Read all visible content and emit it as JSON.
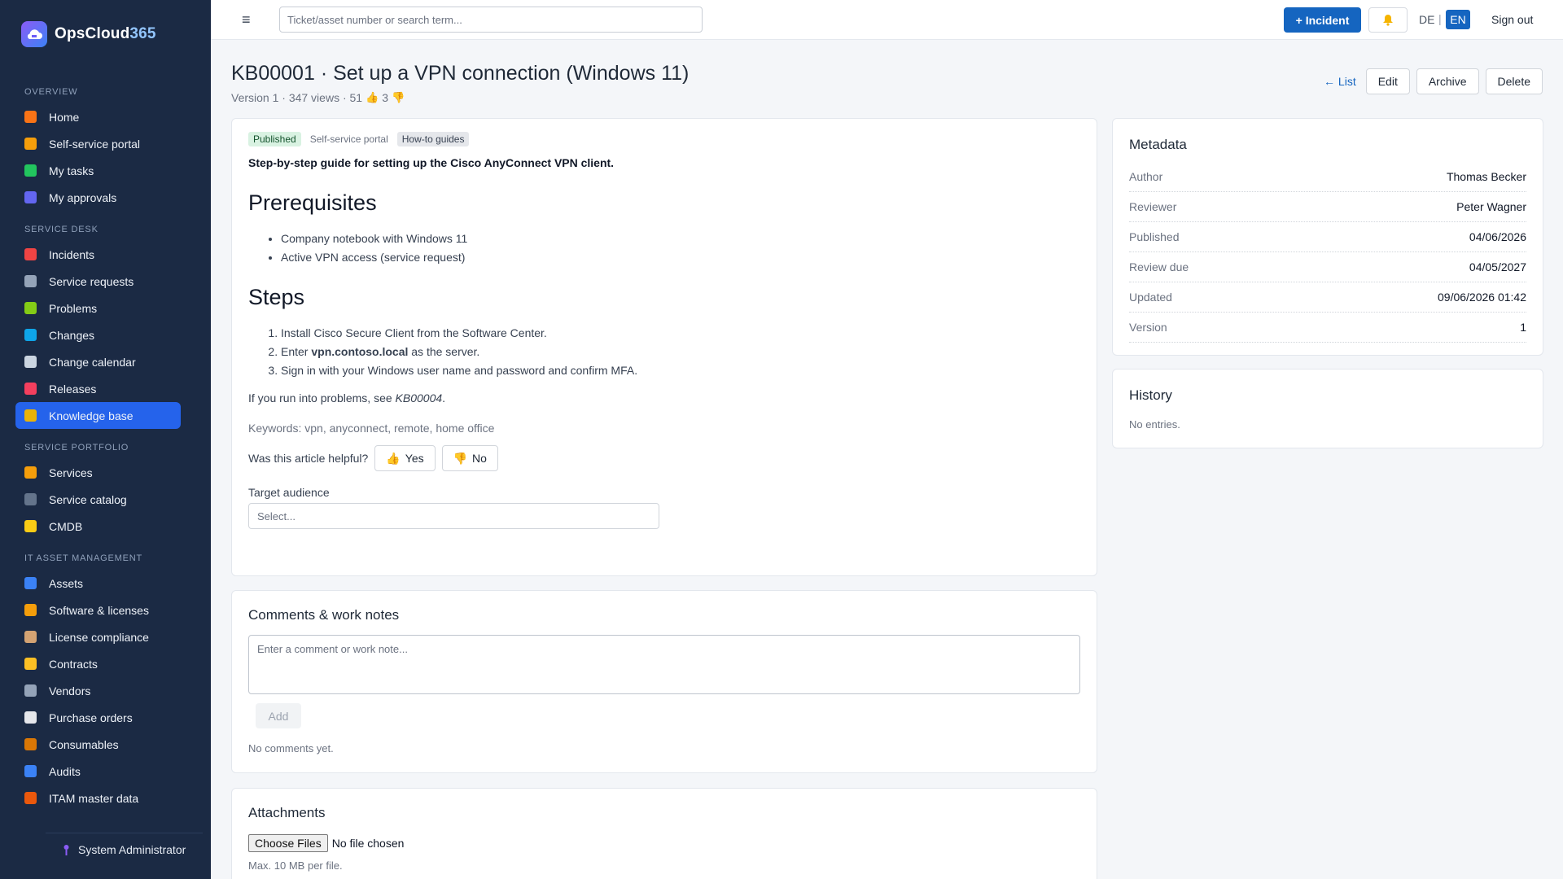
{
  "brand": {
    "name_main": "OpsCloud",
    "name_accent": "365"
  },
  "sidebar": {
    "sections": [
      {
        "label": "OVERVIEW",
        "items": [
          {
            "label": "Home",
            "icon": "home-icon",
            "color": "#f97316"
          },
          {
            "label": "Self-service portal",
            "icon": "person-icon",
            "color": "#f59e0b"
          },
          {
            "label": "My tasks",
            "icon": "checkbox-icon",
            "color": "#22c55e"
          },
          {
            "label": "My approvals",
            "icon": "checkmark-icon",
            "color": "#6366f1"
          }
        ]
      },
      {
        "label": "SERVICE DESK",
        "items": [
          {
            "label": "Incidents",
            "icon": "siren-icon",
            "color": "#ef4444"
          },
          {
            "label": "Service requests",
            "icon": "inbox-icon",
            "color": "#94a3b8"
          },
          {
            "label": "Problems",
            "icon": "puzzle-icon",
            "color": "#84cc16"
          },
          {
            "label": "Changes",
            "icon": "refresh-icon",
            "color": "#0ea5e9"
          },
          {
            "label": "Change calendar",
            "icon": "calendar-icon",
            "color": "#cbd5e1"
          },
          {
            "label": "Releases",
            "icon": "rocket-icon",
            "color": "#f43f5e"
          },
          {
            "label": "Knowledge base",
            "icon": "books-icon",
            "color": "#eab308",
            "active": true
          }
        ]
      },
      {
        "label": "SERVICE PORTFOLIO",
        "items": [
          {
            "label": "Services",
            "icon": "bell-service-icon",
            "color": "#f59e0b"
          },
          {
            "label": "Service catalog",
            "icon": "catalog-icon",
            "color": "#64748b"
          },
          {
            "label": "CMDB",
            "icon": "folder-icon",
            "color": "#facc15"
          }
        ]
      },
      {
        "label": "IT ASSET MANAGEMENT",
        "items": [
          {
            "label": "Assets",
            "icon": "laptop-icon",
            "color": "#3b82f6"
          },
          {
            "label": "Software & licenses",
            "icon": "disc-icon",
            "color": "#f59e0b"
          },
          {
            "label": "License compliance",
            "icon": "scales-icon",
            "color": "#d4a373"
          },
          {
            "label": "Contracts",
            "icon": "document-icon",
            "color": "#fbbf24"
          },
          {
            "label": "Vendors",
            "icon": "building-icon",
            "color": "#94a3b8"
          },
          {
            "label": "Purchase orders",
            "icon": "receipt-icon",
            "color": "#e5e7eb"
          },
          {
            "label": "Consumables",
            "icon": "package-icon",
            "color": "#d97706"
          },
          {
            "label": "Audits",
            "icon": "magnifier-icon",
            "color": "#3b82f6"
          },
          {
            "label": "ITAM master data",
            "icon": "bricks-icon",
            "color": "#ea580c"
          }
        ]
      }
    ],
    "user": "System Administrator"
  },
  "topbar": {
    "search_placeholder": "Ticket/asset number or search term...",
    "incident_button": "+ Incident",
    "lang_de": "DE",
    "lang_sep": "|",
    "lang_en": "EN",
    "signout": "Sign out"
  },
  "page": {
    "title": "KB00001 · Set up a VPN connection (Windows 11)",
    "meta_prefix": "Version 1 · 347 views · 51",
    "meta_down": "3",
    "back_link": "← List",
    "edit": "Edit",
    "archive": "Archive",
    "delete": "Delete"
  },
  "article": {
    "tags": {
      "status": "Published",
      "audience": "Self-service portal",
      "category": "How-to guides"
    },
    "lead": "Step-by-step guide for setting up the Cisco AnyConnect VPN client.",
    "prereq_heading": "Prerequisites",
    "prereqs": [
      "Company notebook with Windows 11",
      "Active VPN access (service request)"
    ],
    "steps_heading": "Steps",
    "step1": "Install Cisco Secure Client from the Software Center.",
    "step2_pre": "Enter ",
    "step2_bold": "vpn.contoso.local",
    "step2_post": " as the server.",
    "step3": "Sign in with your Windows user name and password and confirm MFA.",
    "problems_pre": "If you run into problems, see ",
    "problems_ref": "KB00004",
    "problems_post": ".",
    "keywords": "Keywords: vpn, anyconnect, remote, home office",
    "helpful_label": "Was this article helpful?",
    "yes": "Yes",
    "no": "No",
    "audience_label": "Target audience",
    "audience_value": "Select..."
  },
  "comments": {
    "title": "Comments & work notes",
    "placeholder": "Enter a comment or work note...",
    "add": "Add",
    "empty": "No comments yet."
  },
  "attachments": {
    "title": "Attachments",
    "choose": "Choose Files",
    "no_file": "No file chosen",
    "hint": "Max. 10 MB per file."
  },
  "metadata": {
    "title": "Metadata",
    "rows": [
      {
        "k": "Author",
        "v": "Thomas Becker"
      },
      {
        "k": "Reviewer",
        "v": "Peter Wagner"
      },
      {
        "k": "Published",
        "v": "04/06/2026"
      },
      {
        "k": "Review due",
        "v": "04/05/2027"
      },
      {
        "k": "Updated",
        "v": "09/06/2026 01:42"
      },
      {
        "k": "Version",
        "v": "1"
      }
    ]
  },
  "history": {
    "title": "History",
    "empty": "No entries."
  },
  "colors": {
    "primary": "#1565c0",
    "sidebar_bg": "#1b2a44",
    "published_tag": "#d9f2e2"
  }
}
